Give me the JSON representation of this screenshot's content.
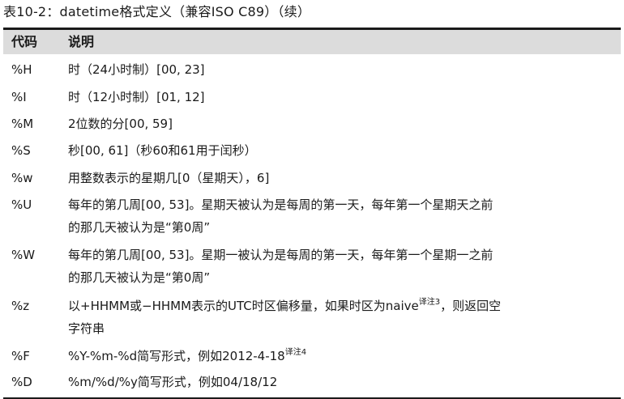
{
  "caption": "表10-2：datetime格式定义（兼容ISO C89）（续）",
  "header": {
    "col_code": "代码",
    "col_desc": "说明"
  },
  "rows": [
    {
      "code": "%H",
      "lines": [
        "时（24小时制）[00, 23]"
      ]
    },
    {
      "code": "%I",
      "lines": [
        "时（12小时制）[01, 12]"
      ]
    },
    {
      "code": "%M",
      "lines": [
        "2位数的分[00, 59]"
      ]
    },
    {
      "code": "%S",
      "lines": [
        "秒[00, 61]（秒60和61用于闰秒）"
      ]
    },
    {
      "code": "%w",
      "lines": [
        "用整数表示的星期几[0（星期天），6]"
      ]
    },
    {
      "code": "%U",
      "lines": [
        "每年的第几周[00, 53]。星期天被认为是每周的第一天，每年第一个星期天之前",
        "的那几天被认为是“第0周”"
      ]
    },
    {
      "code": "%W",
      "lines": [
        "每年的第几周[00, 53]。星期一被认为是每周的第一天，每年第一个星期一之前",
        "的那几天被认为是“第0周”"
      ]
    },
    {
      "code": "%z",
      "line1_main": "以+HHMM或−HHMM表示的UTC时区偏移量，如果时区为naive",
      "line1_note": "译注3",
      "line1_tail": "，则返回空",
      "line2": "字符串"
    },
    {
      "code": "%F",
      "line1_main": "%Y-%m-%d简写形式，例如2012-4-18",
      "line1_note": "译注4"
    },
    {
      "code": "%D",
      "lines": [
        "%m/%d/%y简写形式，例如04/18/12"
      ]
    }
  ]
}
